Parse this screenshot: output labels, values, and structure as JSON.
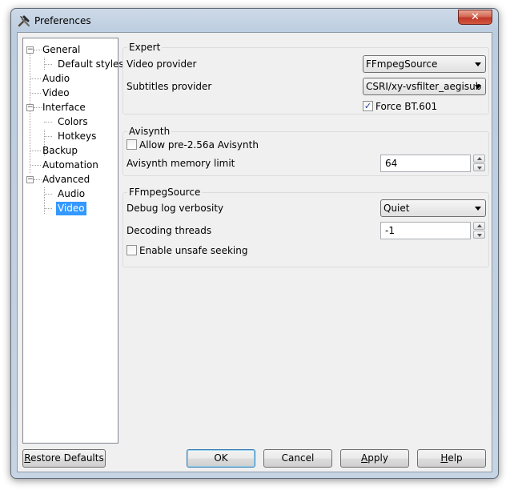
{
  "window": {
    "title": "Preferences",
    "close_glyph": "✕"
  },
  "tree": {
    "expander_glyph": "−",
    "items": [
      {
        "label": "General"
      },
      {
        "label": "Default styles"
      },
      {
        "label": "Audio"
      },
      {
        "label": "Video"
      },
      {
        "label": "Interface"
      },
      {
        "label": "Colors"
      },
      {
        "label": "Hotkeys"
      },
      {
        "label": "Backup"
      },
      {
        "label": "Automation"
      },
      {
        "label": "Advanced"
      },
      {
        "label": "Audio"
      },
      {
        "label": "Video",
        "selected": true
      }
    ]
  },
  "expert": {
    "title": "Expert",
    "video_provider_label": "Video provider",
    "video_provider_value": "FFmpegSource",
    "subtitles_provider_label": "Subtitles provider",
    "subtitles_provider_value": "CSRI/xy-vsfilter_aegisub",
    "force_bt601_label": "Force BT.601",
    "force_bt601_checked": true,
    "check_glyph": "✓"
  },
  "avisynth": {
    "title": "Avisynth",
    "allow_pre_label": "Allow pre-2.56a Avisynth",
    "allow_pre_checked": false,
    "memory_limit_label": "Avisynth memory limit",
    "memory_limit_value": "64"
  },
  "ffmpegsource": {
    "title": "FFmpegSource",
    "debug_log_label": "Debug log verbosity",
    "debug_log_value": "Quiet",
    "decoding_threads_label": "Decoding threads",
    "decoding_threads_value": "-1",
    "unsafe_seeking_label": "Enable unsafe seeking",
    "unsafe_seeking_checked": false
  },
  "buttons": {
    "restore": {
      "prefix": "R",
      "rest": "estore Defaults"
    },
    "ok": "OK",
    "cancel": "Cancel",
    "apply": {
      "prefix": "A",
      "rest": "pply"
    },
    "help": {
      "prefix": "H",
      "rest": "elp"
    }
  },
  "colors": {
    "selection": "#3399ff",
    "close_button": "#c7402f"
  }
}
